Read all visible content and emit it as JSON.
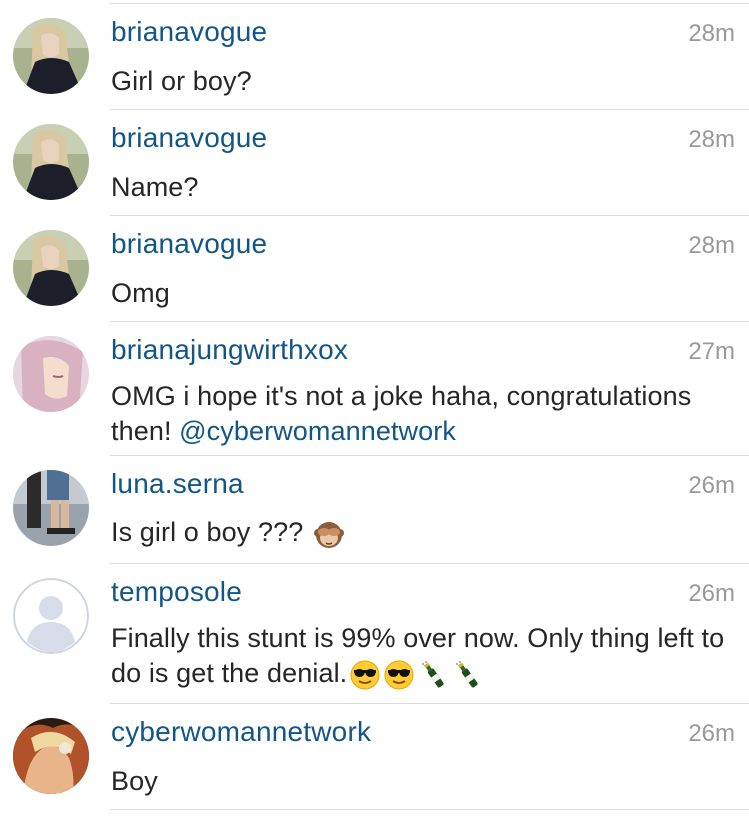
{
  "comments": [
    {
      "username": "brianavogue",
      "time": "28m",
      "text": "Girl or boy?",
      "avatar_icon": "blonde-woman-avatar"
    },
    {
      "username": "brianavogue",
      "time": "28m",
      "text": "Name?",
      "avatar_icon": "blonde-woman-avatar"
    },
    {
      "username": "brianavogue",
      "time": "28m",
      "text": "Omg",
      "avatar_icon": "blonde-woman-avatar"
    },
    {
      "username": "brianajungwirthxox",
      "time": "27m",
      "text": "OMG i hope it's not a joke haha, congratulations then! ",
      "mention": "@cyberwomannetwork",
      "avatar_icon": "pink-hair-avatar"
    },
    {
      "username": "luna.serna",
      "time": "26m",
      "text": "Is girl o boy ??? ",
      "emojis": [
        "see-no-evil-monkey-emoji"
      ],
      "avatar_icon": "legs-photo-avatar"
    },
    {
      "username": "temposole",
      "time": "26m",
      "text": "Finally this stunt is 99% over now. Only thing left to do is get the denial.",
      "emojis": [
        "sunglasses-face-emoji",
        "sunglasses-face-emoji",
        "champagne-bottle-emoji",
        "champagne-bottle-emoji"
      ],
      "avatar_icon": "default-user-silhouette-avatar"
    },
    {
      "username": "cyberwomannetwork",
      "time": "26m",
      "text": "Boy",
      "avatar_icon": "fire-portrait-avatar"
    }
  ],
  "colors": {
    "username": "#125688",
    "text": "#262626",
    "time": "#999999",
    "divider": "#dbdbdb"
  }
}
